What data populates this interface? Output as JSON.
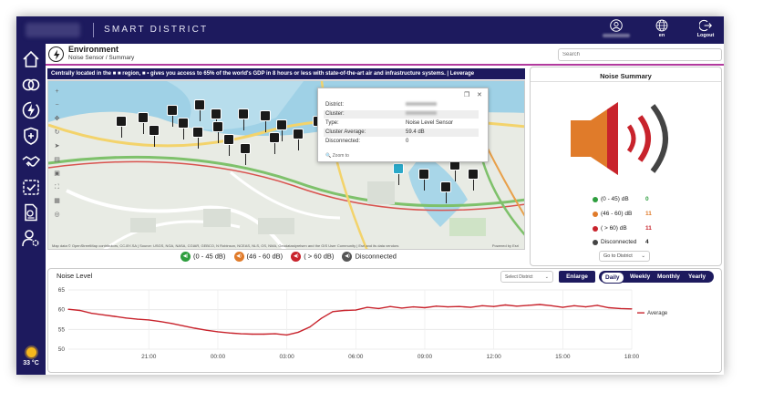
{
  "topbar": {
    "brand": "SMART DISTRICT",
    "lang_label": "en",
    "logout_label": "Logout"
  },
  "header": {
    "title": "Environment",
    "breadcrumb": "Noise Sensor / Summary",
    "search_placeholder": "Search"
  },
  "ticker": {
    "text": "Centrally located in the ■ ■ region, ■ • gives you access to 65% of the world's GDP in 8 hours or less with state-of-the-art air and infrastructure systems.   |   Leverage"
  },
  "map": {
    "popup": {
      "rows": [
        {
          "key": "District:",
          "value": ""
        },
        {
          "key": "Cluster:",
          "value": ""
        },
        {
          "key": "Type:",
          "value": "Noise Level Sensor"
        },
        {
          "key": "Cluster Average:",
          "value": "59.4 dB"
        },
        {
          "key": "Disconnected:",
          "value": "0"
        }
      ],
      "zoom_label": "Zoom to"
    },
    "attribution": "Map data © OpenStreetMap contributors, CC-BY-SA | Source: USGS, NGA, NASA, CGIAR, GEBCO, N Robinson, NCEAS, NLS, OS, NMA, Geodatastyrelsen and the GIS User Community | Esri and its data vendors",
    "attribution_right": "Powered by Esri"
  },
  "legend": [
    {
      "label": "(0 - 45 dB)",
      "color": "#2e9e3e"
    },
    {
      "label": "(46 - 60 dB)",
      "color": "#e07b2a"
    },
    {
      "label": "( > 60 dB)",
      "color": "#c8232c"
    },
    {
      "label": "Disconnected",
      "color": "#555555"
    }
  ],
  "noise_summary": {
    "title": "Noise Summary",
    "rows": [
      {
        "label": "(0 - 45) dB",
        "count": "0",
        "color": "#2e9e3e"
      },
      {
        "label": "(46 - 60) dB",
        "count": "11",
        "color": "#e07b2a"
      },
      {
        "label": "( > 60) dB",
        "count": "11",
        "color": "#c8232c"
      },
      {
        "label": "Disconnected",
        "count": "4",
        "color": "#444444"
      }
    ],
    "goto_label": "Go to District"
  },
  "noise_level": {
    "title": "Noise Level",
    "select_label": "Select District",
    "enlarge_label": "Enlarge",
    "periods": [
      "Daily",
      "Weekly",
      "Monthly",
      "Yearly"
    ],
    "active_period": "Daily"
  },
  "weather": {
    "temp": "33 °C"
  },
  "colors": {
    "navy": "#1d1a5e",
    "accent": "#b23a9e",
    "line": "#c8232c"
  },
  "chart_data": {
    "type": "line",
    "title": "",
    "xlabel": "",
    "ylabel": "",
    "ylim": [
      50,
      65
    ],
    "yticks": [
      50,
      55,
      60,
      65
    ],
    "xticks": [
      "21:00",
      "00:00",
      "03:00",
      "06:00",
      "09:00",
      "12:00",
      "15:00",
      "18:00"
    ],
    "x_hours": [
      17.5,
      18,
      18.5,
      19,
      19.5,
      20,
      20.5,
      21,
      21.5,
      22,
      22.5,
      23,
      23.5,
      24,
      24.5,
      25,
      25.5,
      26,
      26.5,
      27,
      27.5,
      28,
      28.5,
      29,
      29.5,
      30,
      30.5,
      31,
      31.5,
      32,
      32.5,
      33,
      33.5,
      34,
      34.5,
      35,
      35.5,
      36,
      36.5,
      37,
      37.5,
      38,
      38.5,
      39,
      39.5,
      40,
      40.5,
      41,
      41.5,
      42
    ],
    "series": [
      {
        "name": "Average",
        "values": [
          60.1,
          59.8,
          59.1,
          58.7,
          58.3,
          57.9,
          57.6,
          57.4,
          57.0,
          56.5,
          55.9,
          55.3,
          54.8,
          54.4,
          54.1,
          53.9,
          53.8,
          53.8,
          53.9,
          53.6,
          54.3,
          55.6,
          57.8,
          59.5,
          59.8,
          59.9,
          60.6,
          60.3,
          60.8,
          60.4,
          60.7,
          60.5,
          60.9,
          60.7,
          60.8,
          60.6,
          61.0,
          60.8,
          61.2,
          60.9,
          61.1,
          61.3,
          61.0,
          60.6,
          61.0,
          60.7,
          61.1,
          60.5,
          60.3,
          60.2
        ]
      }
    ],
    "legend_position": "right",
    "grid": true
  }
}
